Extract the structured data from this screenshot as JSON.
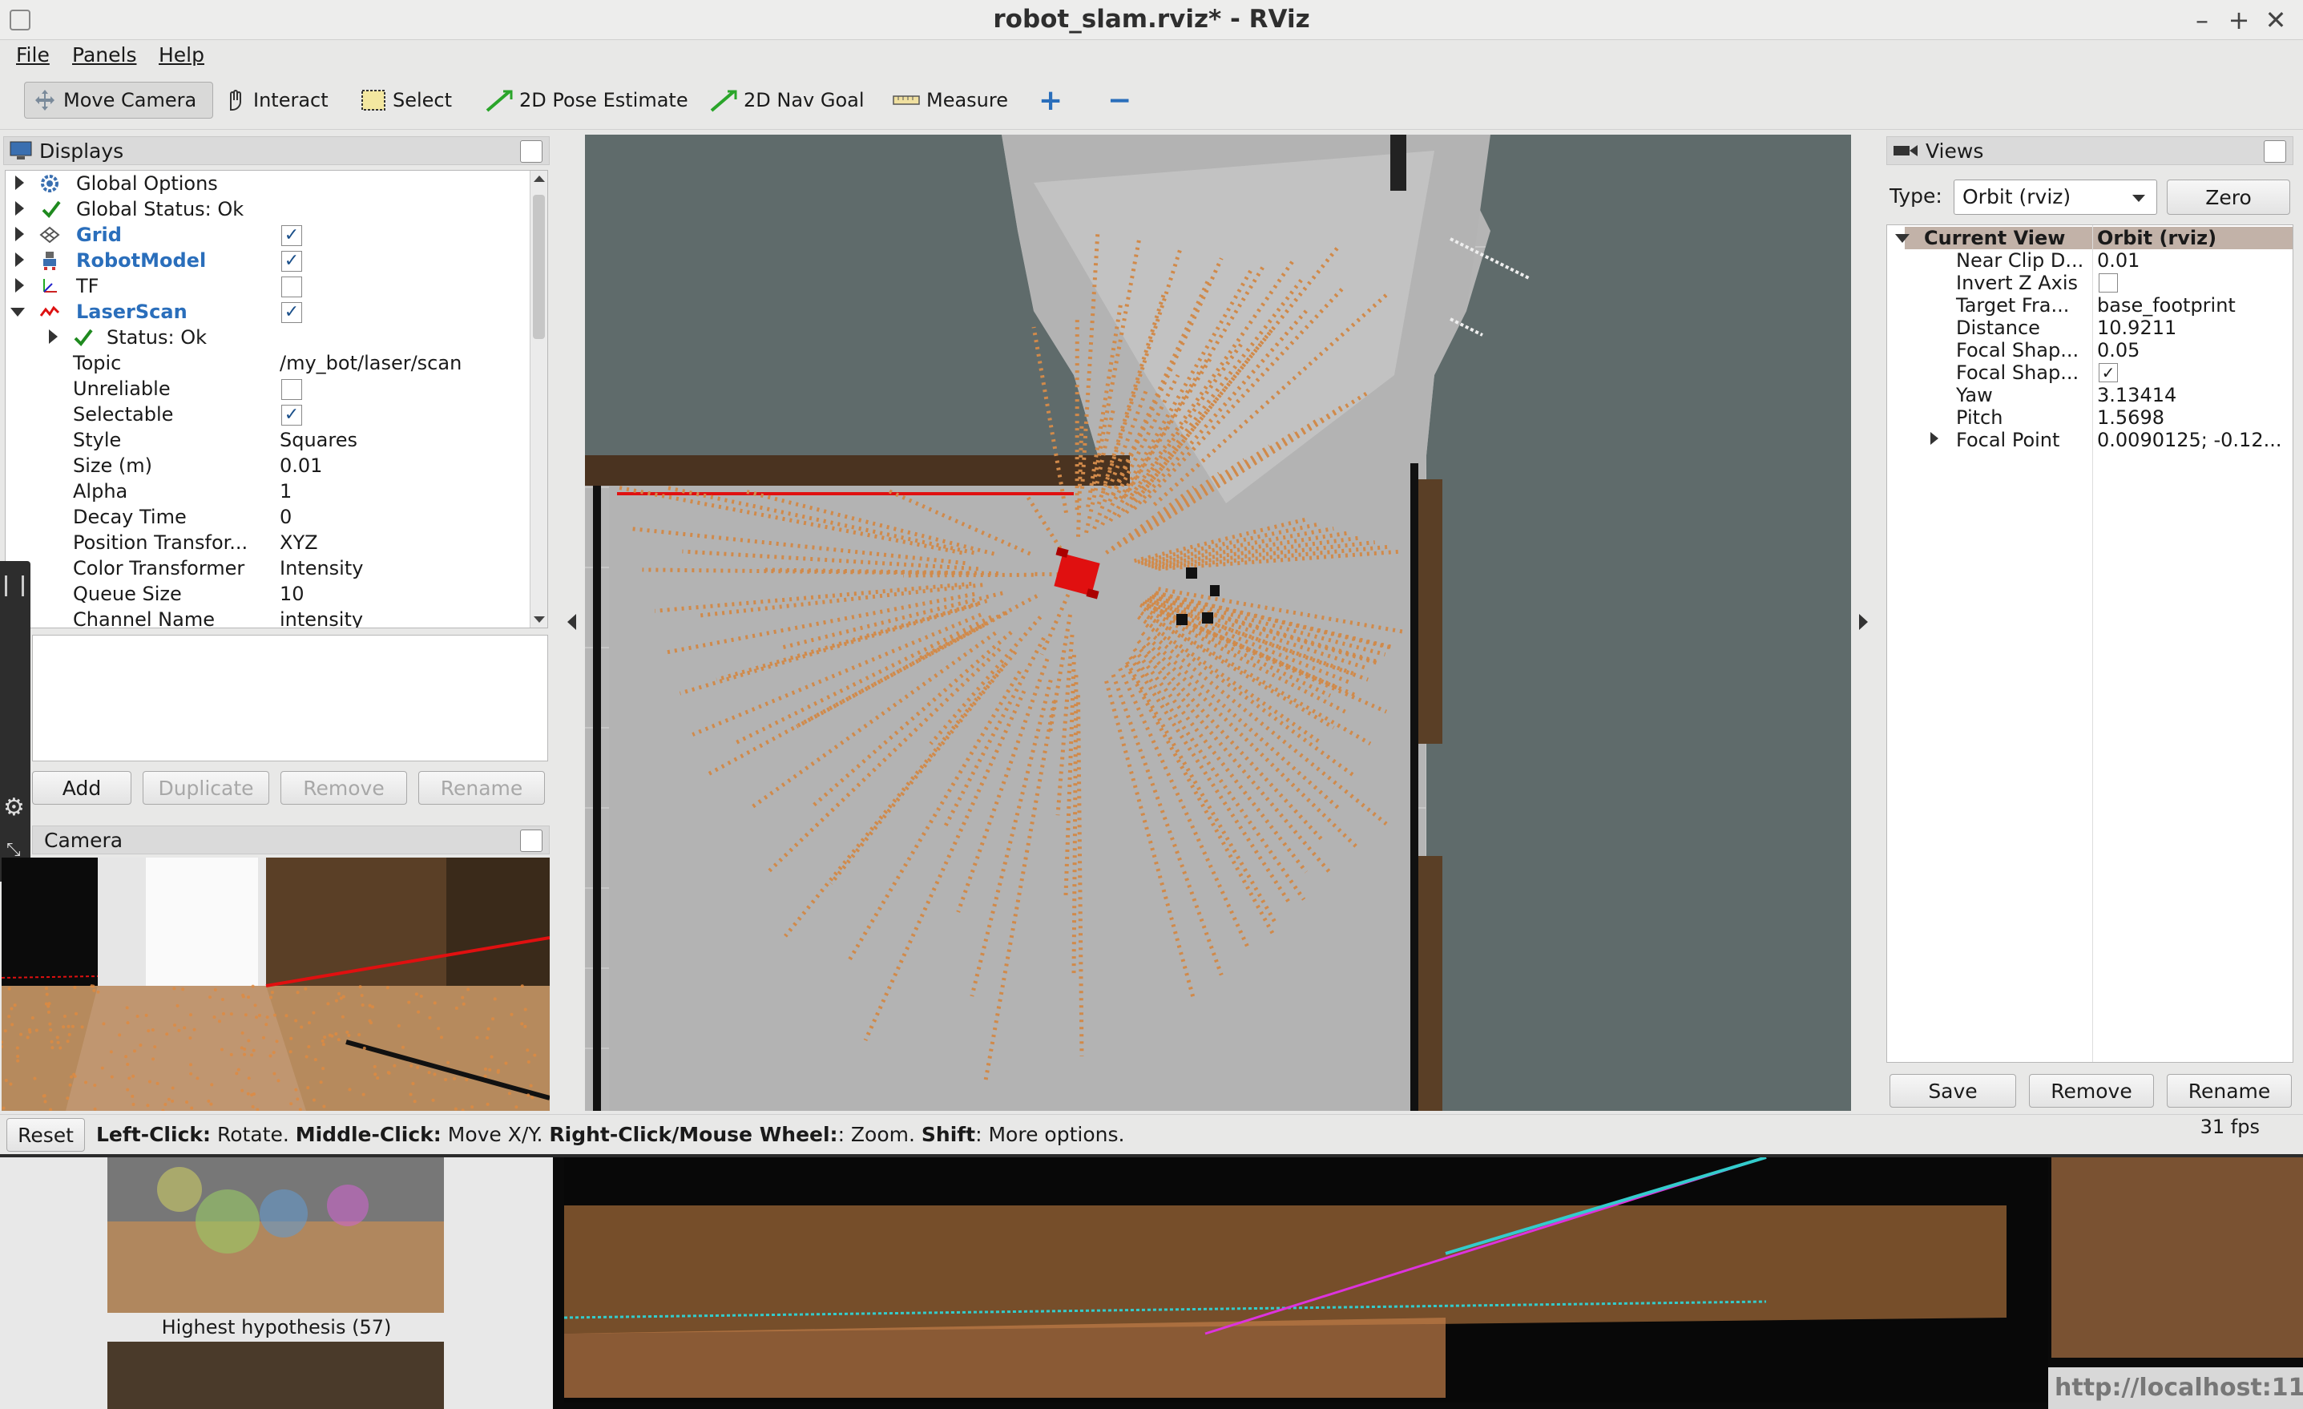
{
  "window": {
    "title": "robot_slam.rviz* - RViz",
    "min": "–",
    "max": "+",
    "close": "✕"
  },
  "menu": {
    "file": "File",
    "panels": "Panels",
    "help": "Help"
  },
  "toolbar": {
    "move_camera": "Move Camera",
    "interact": "Interact",
    "select": "Select",
    "pose_estimate": "2D Pose Estimate",
    "nav_goal": "2D Nav Goal",
    "measure": "Measure",
    "add_tool": "+",
    "remove_tool": "−"
  },
  "displays": {
    "header": "Displays",
    "items": [
      {
        "label": "Global Options",
        "icon": "gear-icon"
      },
      {
        "label": "Global Status: Ok",
        "icon": "check-icon"
      },
      {
        "label": "Grid",
        "icon": "grid-icon",
        "checked": true
      },
      {
        "label": "RobotModel",
        "icon": "robot-icon",
        "checked": true
      },
      {
        "label": "TF",
        "icon": "tf-axes-icon",
        "checked": false
      },
      {
        "label": "LaserScan",
        "icon": "laser-icon",
        "checked": true
      }
    ],
    "laser_props": {
      "status": "Status: Ok",
      "topic": {
        "name": "Topic",
        "value": "/my_bot/laser/scan"
      },
      "unreliable": {
        "name": "Unreliable",
        "checked": false
      },
      "selectable": {
        "name": "Selectable",
        "checked": true
      },
      "style": {
        "name": "Style",
        "value": "Squares"
      },
      "size": {
        "name": "Size (m)",
        "value": "0.01"
      },
      "alpha": {
        "name": "Alpha",
        "value": "1"
      },
      "decay": {
        "name": "Decay Time",
        "value": "0"
      },
      "position_transformer": {
        "name": "Position Transfor...",
        "value": "XYZ"
      },
      "color_transformer": {
        "name": "Color Transformer",
        "value": "Intensity"
      },
      "queue_size": {
        "name": "Queue Size",
        "value": "10"
      },
      "channel_name": {
        "name": "Channel Name",
        "value": "intensity"
      }
    },
    "buttons": {
      "add": "Add",
      "duplicate": "Duplicate",
      "remove": "Remove",
      "rename": "Rename"
    }
  },
  "camera": {
    "header": "Camera"
  },
  "views": {
    "header": "Views",
    "type_label": "Type:",
    "type_value": "Orbit (rviz)",
    "zero": "Zero",
    "current_view": {
      "name": "Current View",
      "value": "Orbit (rviz)"
    },
    "props": [
      {
        "name": "Near Clip D...",
        "value": "0.01"
      },
      {
        "name": "Invert Z Axis",
        "checked": false
      },
      {
        "name": "Target Fra...",
        "value": "base_footprint"
      },
      {
        "name": "Distance",
        "value": "10.9211"
      },
      {
        "name": "Focal Shap...",
        "value": "0.05"
      },
      {
        "name": "Focal Shap...",
        "checked": true
      },
      {
        "name": "Yaw",
        "value": "3.13414"
      },
      {
        "name": "Pitch",
        "value": "1.5698"
      },
      {
        "name": "Focal Point",
        "value": "0.0090125; -0.12..."
      }
    ],
    "buttons": {
      "save": "Save",
      "remove": "Remove",
      "rename": "Rename"
    }
  },
  "status": {
    "reset": "Reset",
    "k1": "Left-Click:",
    "t1": " Rotate. ",
    "k2": "Middle-Click:",
    "t2": " Move X/Y. ",
    "k3": "Right-Click/Mouse Wheel:",
    "t3": ": Zoom. ",
    "k4": "Shift",
    "t4": ": More options.",
    "fps": "31 fps"
  },
  "background": {
    "hypothesis_label": "Highest hypothesis (57)",
    "url_fragment": "http://localhost:11"
  },
  "colors": {
    "scan": "#d18a4a",
    "robot": "#e01010",
    "wall": "#5f6b6b",
    "free": "#b3b3b3"
  }
}
